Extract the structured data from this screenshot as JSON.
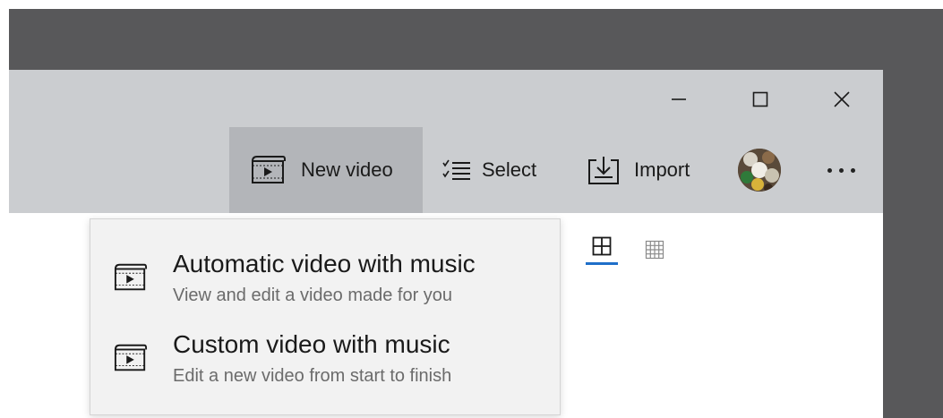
{
  "window": {
    "controls": {
      "minimize_icon": "minimize-icon",
      "maximize_icon": "maximize-icon",
      "close_icon": "close-icon"
    }
  },
  "toolbar": {
    "new_video_label": "New video",
    "select_label": "Select",
    "import_label": "Import",
    "more_icon": "more-icon",
    "active_bg": "#b3b5b9"
  },
  "view_toggle": {
    "active": "large-grid",
    "accent": "#1f6fc9"
  },
  "new_video_menu": {
    "items": [
      {
        "title": "Automatic video with music",
        "subtitle": "View and edit a video made for you",
        "icon": "video-project-icon"
      },
      {
        "title": "Custom video with music",
        "subtitle": "Edit a new video from start to finish",
        "icon": "video-project-icon"
      }
    ]
  },
  "colors": {
    "titlebar": "#cbcdd0",
    "menu_bg": "#f2f2f2",
    "desktop": "#58585a"
  }
}
